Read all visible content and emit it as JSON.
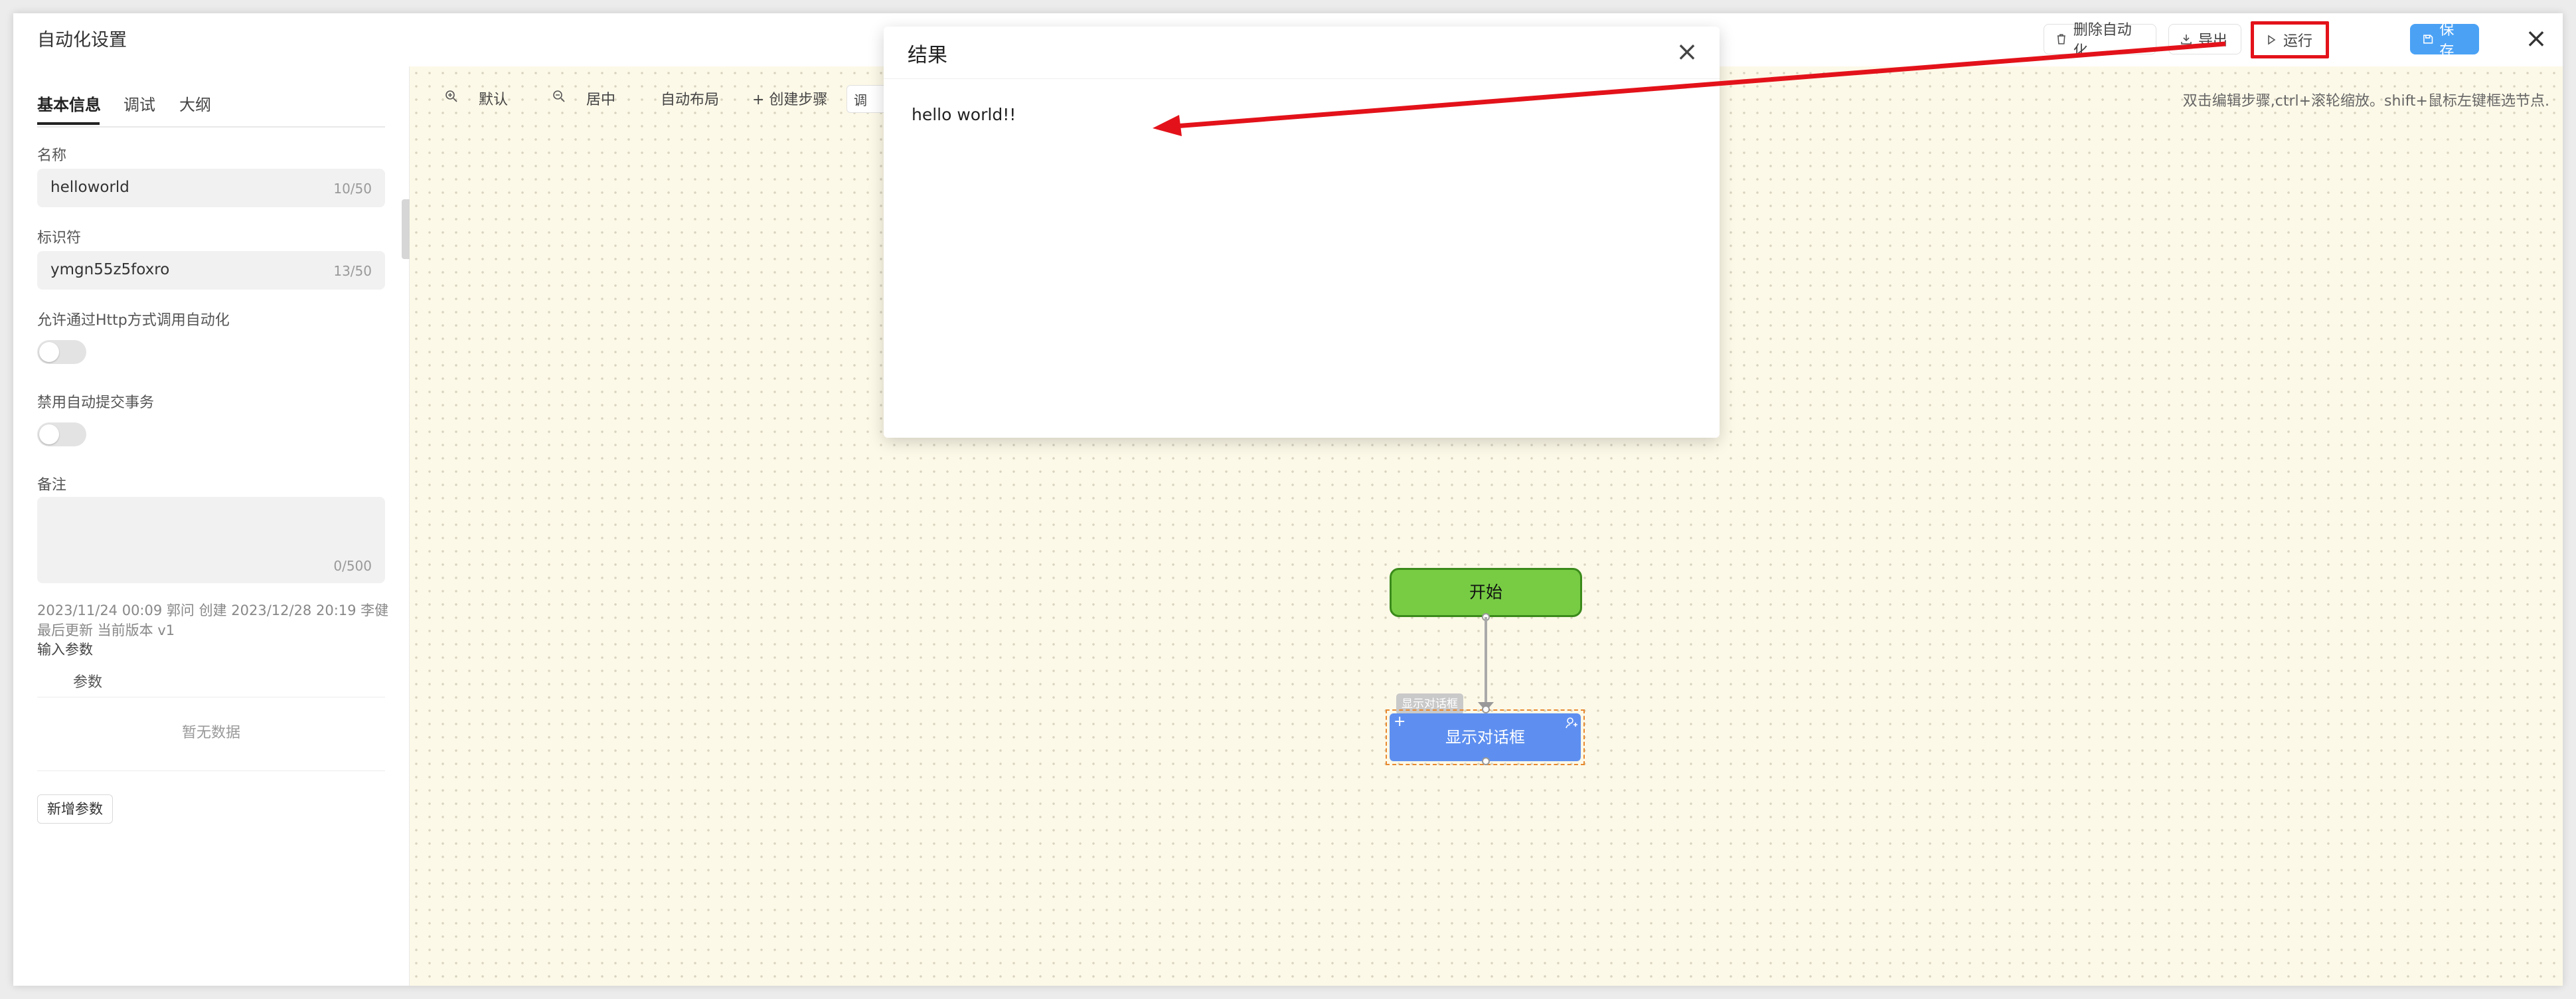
{
  "window": {
    "title": "自动化设置",
    "buttons": {
      "delete": "删除自动化",
      "export": "导出",
      "run": "运行",
      "save": "保存"
    }
  },
  "sidebar": {
    "tabs": [
      "基本信息",
      "调试",
      "大纲"
    ],
    "name_label": "名称",
    "name_value": "helloworld",
    "name_count": "10/50",
    "id_label": "标识符",
    "id_value": "ymgn55z5foxro",
    "id_count": "13/50",
    "http_label": "允许通过Http方式调用自动化",
    "http_enabled": false,
    "autocommit_label": "禁用自动提交事务",
    "autocommit_enabled": false,
    "remark_label": "备注",
    "remark_count": "0/500",
    "meta": "2023/11/24 00:09 郭问 创建 2023/12/28 20:19 李健 最后更新 当前版本 v1",
    "input_params_label": "输入参数",
    "params_column": "参数",
    "empty_text": "暂无数据",
    "add_param": "新增参数"
  },
  "toolbar": {
    "default": "默认",
    "center": "居中",
    "auto_layout": "自动布局",
    "create_step": "+ 创建步骤",
    "partial": "调",
    "hint": "双击编辑步骤,ctrl+滚轮缩放。shift+鼠标左键框选节点."
  },
  "flow": {
    "start_node": "开始",
    "dialog_tag": "显示对话框",
    "dialog_node": "显示对话框"
  },
  "modal": {
    "title": "结果",
    "body": "hello world!!"
  },
  "colors": {
    "accent": "#4ba2f5",
    "start_node": "#77cc44",
    "dialog_node": "#5e8ff0",
    "annotation": "#e3121a",
    "canvas": "#fdf9e8"
  }
}
